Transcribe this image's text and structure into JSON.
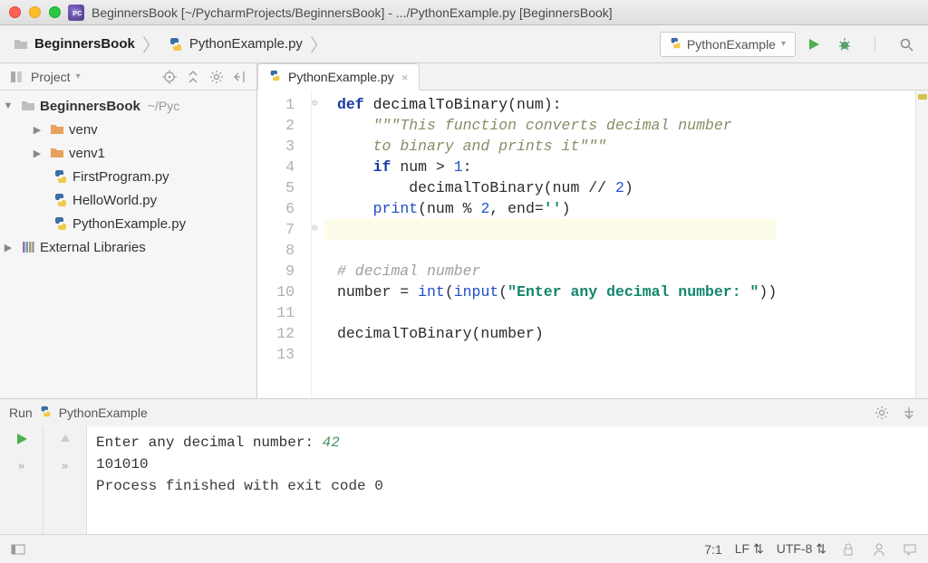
{
  "titlebar": {
    "text": "BeginnersBook [~/PycharmProjects/BeginnersBook] - .../PythonExample.py [BeginnersBook]"
  },
  "breadcrumb": {
    "project": "BeginnersBook",
    "file": "PythonExample.py"
  },
  "runconfig": {
    "name": "PythonExample",
    "arrow": "▾"
  },
  "projectPane": {
    "title": "Project",
    "root": {
      "name": "BeginnersBook",
      "path": "~/PycharmProjects/BeginnersBook"
    },
    "folders": [
      "venv",
      "venv1"
    ],
    "files": [
      "FirstProgram.py",
      "HelloWorld.py",
      "PythonExample.py"
    ],
    "external": "External Libraries"
  },
  "editor": {
    "tab": "PythonExample.py",
    "lineNumbers": [
      "1",
      "2",
      "3",
      "4",
      "5",
      "6",
      "7",
      "8",
      "9",
      "10",
      "11",
      "12",
      "13"
    ],
    "code": {
      "l1_def": "def",
      "l1_fn": "decimalToBinary",
      "l1_rest": "(num):",
      "l2": "\"\"\"This function converts decimal number",
      "l3": "to binary and prints it\"\"\"",
      "l4_if": "if",
      "l4_cond": " num > ",
      "l4_one": "1",
      "l4_colon": ":",
      "l5_call": "decimalToBinary(num // ",
      "l5_two": "2",
      "l5_close": ")",
      "l6_print": "print",
      "l6_mid": "(num % ",
      "l6_two": "2",
      "l6_end": ", end=",
      "l6_str": "''",
      "l6_close": ")",
      "l9": "# decimal number",
      "l10_lhs": "number = ",
      "l10_int": "int",
      "l10_open": "(",
      "l10_input": "input",
      "l10_po": "(",
      "l10_str": "\"Enter any decimal number: \"",
      "l10_close": "))",
      "l12": "decimalToBinary(number)"
    },
    "cursorLine": 7
  },
  "run": {
    "title": "Run",
    "config": "PythonExample",
    "prompt": "Enter any decimal number: ",
    "input": "42",
    "output": "101010",
    "finished": "Process finished with exit code 0",
    "chev": "»"
  },
  "status": {
    "pos": "7:1",
    "le": "LF",
    "enc": "UTF-8",
    "updown": "⇡⇣"
  }
}
